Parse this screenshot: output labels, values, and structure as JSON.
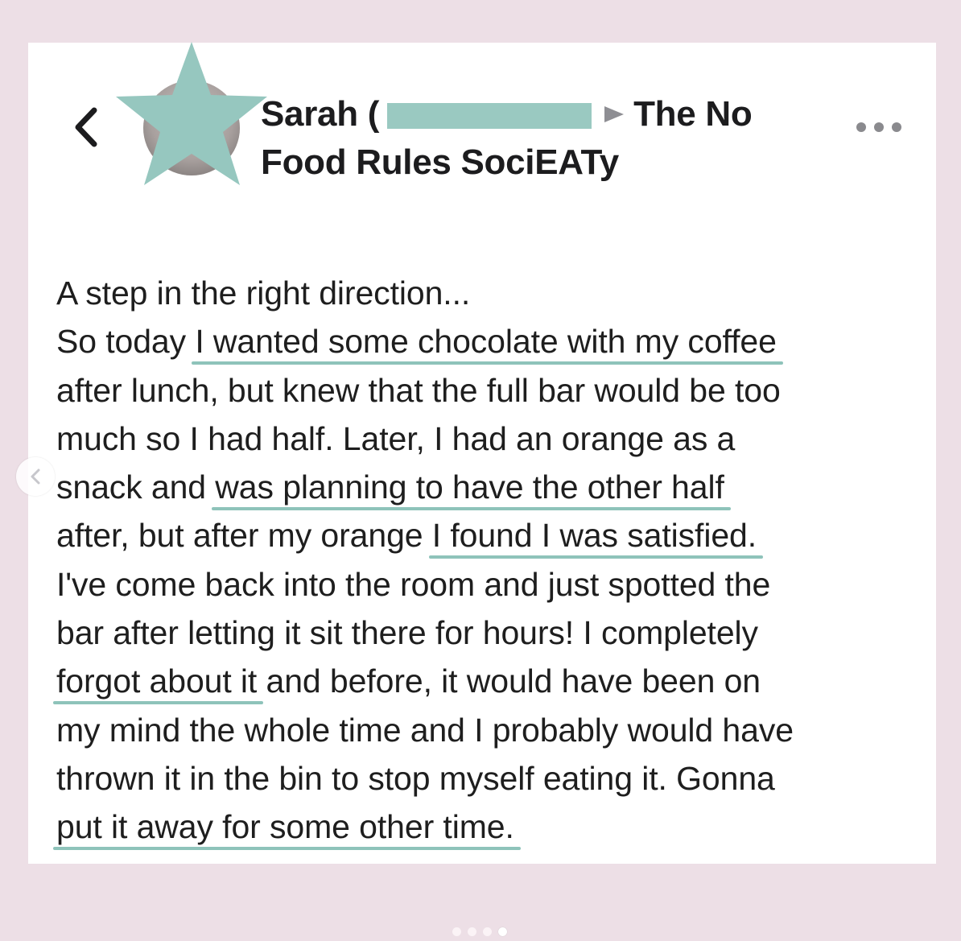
{
  "header": {
    "author_first": "Sarah",
    "author_partial": "(",
    "arrow_icon": "triangle-right-icon",
    "group_line1": "The No",
    "group_line2": "Food Rules SociEATy",
    "back_icon": "chevron-left-icon",
    "more_icon": "more-horizontal-icon"
  },
  "post": {
    "lines": [
      {
        "pre": "A step in the right direction...",
        "hl": "",
        "post": ""
      },
      {
        "pre": "So today ",
        "hl": "I wanted some chocolate with my coffee",
        "post": ""
      },
      {
        "pre": "after lunch, but knew that the full bar would be too",
        "hl": "",
        "post": ""
      },
      {
        "pre": "much so I had half. Later, I had an orange as a",
        "hl": "",
        "post": ""
      },
      {
        "pre": "snack and ",
        "hl": "was planning to have the other half",
        "post": ""
      },
      {
        "pre": "after, but after my orange ",
        "hl": "I found I was satisfied.",
        "post": ""
      },
      {
        "pre": "I've come back into the room and just spotted the",
        "hl": "",
        "post": ""
      },
      {
        "pre": "bar after letting it sit there for hours! I completely",
        "hl": "",
        "post": ""
      },
      {
        "pre": "",
        "hl": "forgot about it",
        "post": " and before, it would have been on"
      },
      {
        "pre": "my mind the whole time and I probably would have",
        "hl": "",
        "post": ""
      },
      {
        "pre": "thrown it in the bin to stop myself eating it. Gonna",
        "hl": "",
        "post": ""
      },
      {
        "pre": "",
        "hl": "put it away for some other time.",
        "post": ""
      }
    ]
  },
  "carousel": {
    "prev_icon": "chevron-left-icon",
    "pages": 4,
    "active_page": 4
  },
  "colors": {
    "background": "#eddfe6",
    "highlight": "#8ec3ba",
    "star": "#96c7bf"
  }
}
